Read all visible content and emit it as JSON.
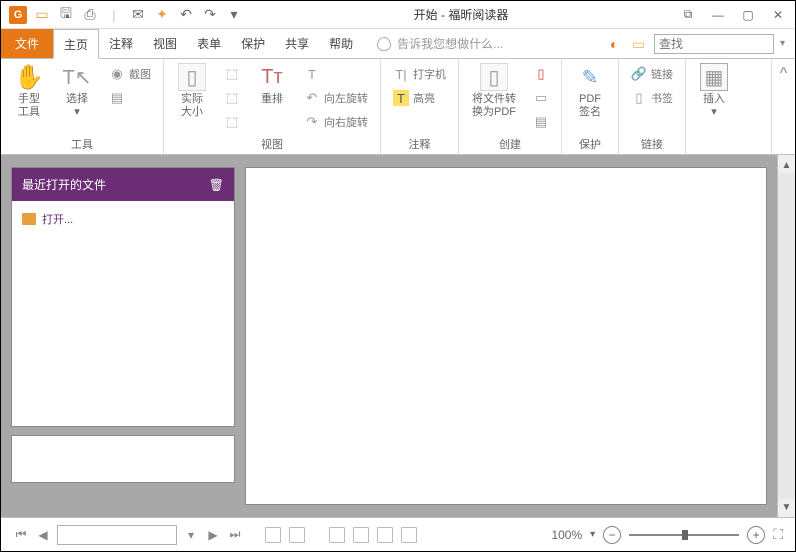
{
  "app": {
    "title": "开始 - 福昕阅读器",
    "logo_letter": "G"
  },
  "tabs": {
    "file": "文件",
    "items": [
      "主页",
      "注释",
      "视图",
      "表单",
      "保护",
      "共享",
      "帮助"
    ],
    "active_index": 0,
    "tellme_placeholder": "告诉我您想做什么...",
    "search_placeholder": "查找"
  },
  "ribbon": {
    "groups": {
      "tools": {
        "label": "工具",
        "hand": "手型\n工具",
        "select": "选择",
        "snapshot": "截图"
      },
      "view": {
        "label": "视图",
        "actual": "实际\n大小",
        "reflow": "重排",
        "text_view": "T",
        "rotate_left": "向左旋转",
        "rotate_right": "向右旋转"
      },
      "comment": {
        "label": "注释",
        "typewriter": "打字机",
        "highlight": "高亮"
      },
      "create": {
        "label": "创建",
        "convert": "将文件转\n换为PDF"
      },
      "protect": {
        "label": "保护",
        "sign": "PDF\n签名"
      },
      "links": {
        "label": "链接",
        "link": "链接",
        "bookmark": "书签"
      },
      "insert": {
        "label": "",
        "insert": "插入"
      }
    }
  },
  "sidebar": {
    "header": "最近打开的文件",
    "open_label": "打开..."
  },
  "status": {
    "zoom_percent": "100%"
  },
  "colors": {
    "accent": "#e67817",
    "sidebar_header": "#6b2d73"
  }
}
